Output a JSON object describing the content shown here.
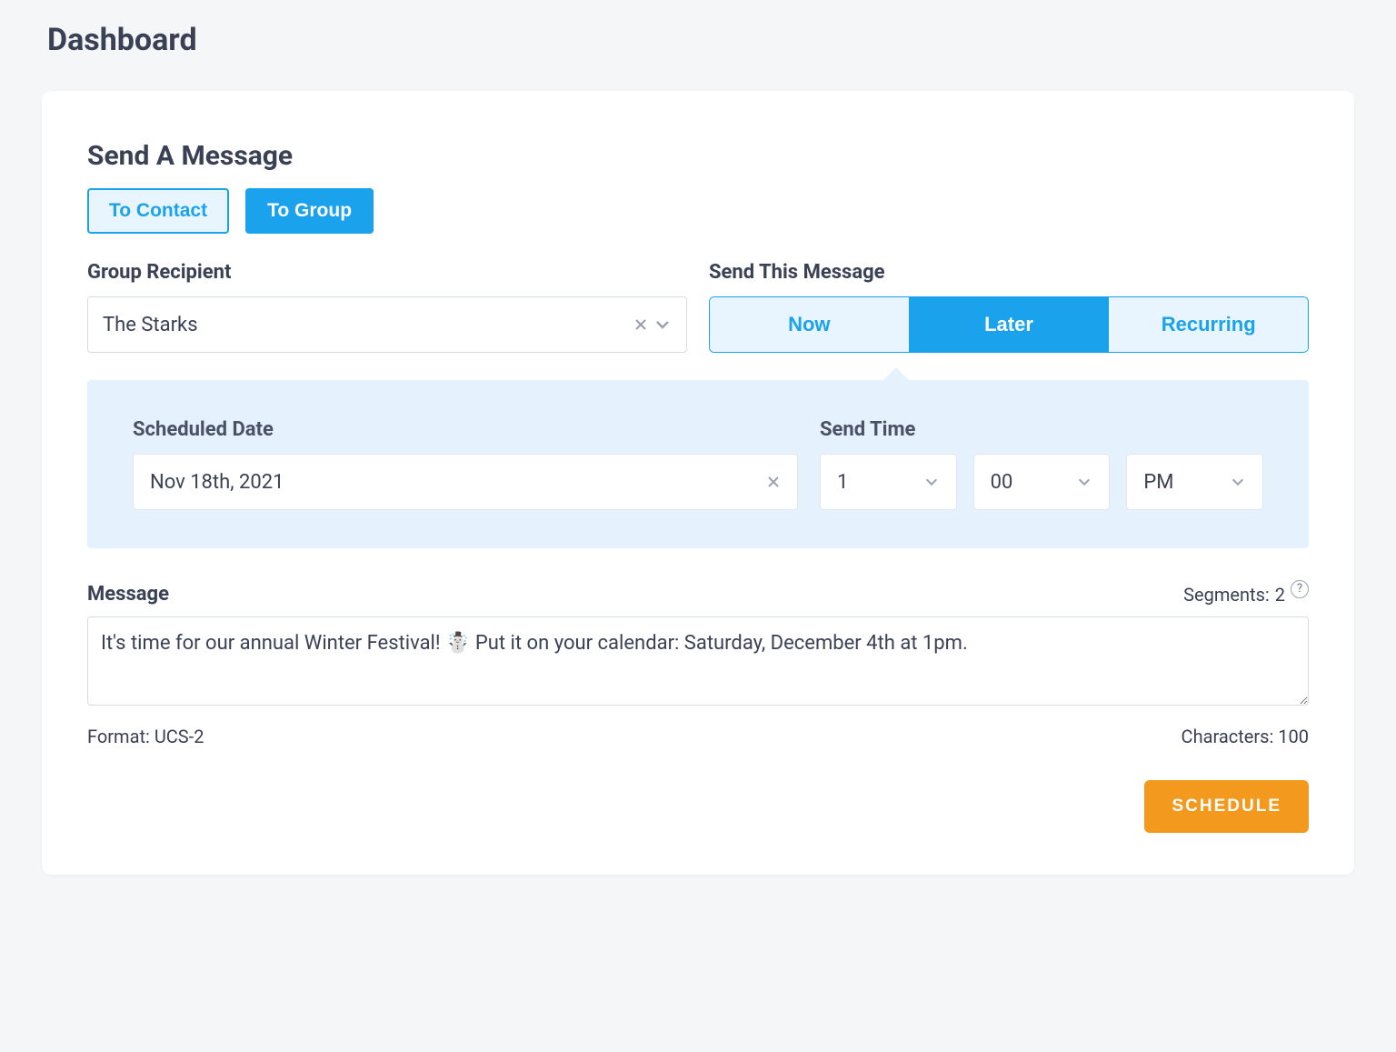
{
  "page": {
    "title": "Dashboard"
  },
  "card": {
    "title": "Send A Message"
  },
  "tabs": {
    "contact": "To Contact",
    "group": "To Group"
  },
  "group_recipient": {
    "label": "Group Recipient",
    "value": "The Starks"
  },
  "send_timing": {
    "label": "Send This Message",
    "options": {
      "now": "Now",
      "later": "Later",
      "recurring": "Recurring"
    }
  },
  "schedule": {
    "date_label": "Scheduled Date",
    "date_value": "Nov 18th, 2021",
    "time_label": "Send Time",
    "hour": "1",
    "minute": "00",
    "ampm": "PM"
  },
  "message": {
    "label": "Message",
    "segments_label": "Segments:",
    "segments_value": "2",
    "body": "It's time for our annual Winter Festival! ☃️ Put it on your calendar: Saturday, December 4th at 1pm.",
    "format_label": "Format:",
    "format_value": "UCS-2",
    "chars_label": "Characters:",
    "chars_value": "100"
  },
  "actions": {
    "schedule": "SCHEDULE"
  }
}
